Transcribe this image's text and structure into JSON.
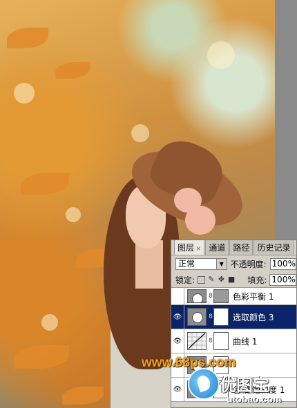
{
  "panel": {
    "tabs": [
      {
        "label": "图层",
        "close": "×"
      },
      {
        "label": "通道"
      },
      {
        "label": "路径"
      },
      {
        "label": "历史记录"
      }
    ],
    "blend_mode": "正常",
    "opacity_label": "不透明度:",
    "opacity_value": "100%",
    "lock_label": "锁定:",
    "fill_label": "填充:",
    "fill_value": "100%",
    "layers": [
      {
        "name": "色彩平衡 1",
        "visible": false,
        "thumb": "gray"
      },
      {
        "name": "选取颜色 3",
        "visible": true,
        "thumb": "gray",
        "selected": true
      },
      {
        "name": "曲线 1",
        "visible": true,
        "thumb": "curve"
      },
      {
        "name": "",
        "visible": true,
        "thumb": "gray"
      },
      {
        "name": "色相/饱和度 1",
        "visible": true,
        "thumb": "gray"
      }
    ]
  },
  "watermark": {
    "site": "www.68ps.com",
    "brand": "优图宝",
    "brand_url": "utobao.com"
  }
}
